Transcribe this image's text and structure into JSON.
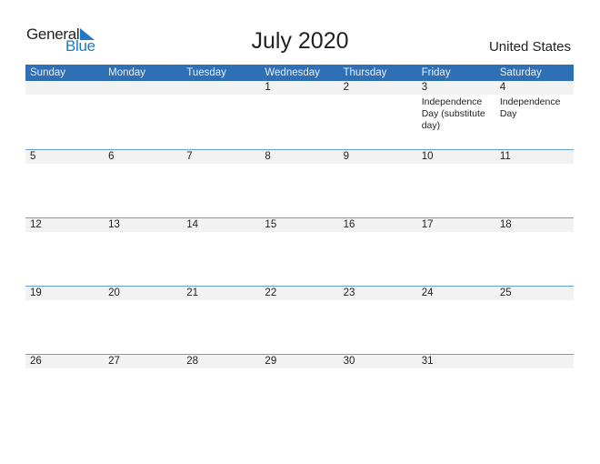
{
  "logo": {
    "general": "General",
    "blue": "Blue",
    "accent_color": "#1f78c8"
  },
  "title": "July 2020",
  "country": "United States",
  "header_color": "#2e6fb5",
  "weekdays": [
    "Sunday",
    "Monday",
    "Tuesday",
    "Wednesday",
    "Thursday",
    "Friday",
    "Saturday"
  ],
  "weeks": [
    [
      {
        "day": ""
      },
      {
        "day": ""
      },
      {
        "day": ""
      },
      {
        "day": "1"
      },
      {
        "day": "2"
      },
      {
        "day": "3",
        "event": "Independence Day (substitute day)"
      },
      {
        "day": "4",
        "event": "Independence Day"
      }
    ],
    [
      {
        "day": "5"
      },
      {
        "day": "6"
      },
      {
        "day": "7"
      },
      {
        "day": "8"
      },
      {
        "day": "9"
      },
      {
        "day": "10"
      },
      {
        "day": "11"
      }
    ],
    [
      {
        "day": "12"
      },
      {
        "day": "13"
      },
      {
        "day": "14"
      },
      {
        "day": "15"
      },
      {
        "day": "16"
      },
      {
        "day": "17"
      },
      {
        "day": "18"
      }
    ],
    [
      {
        "day": "19"
      },
      {
        "day": "20"
      },
      {
        "day": "21"
      },
      {
        "day": "22"
      },
      {
        "day": "23"
      },
      {
        "day": "24"
      },
      {
        "day": "25"
      }
    ],
    [
      {
        "day": "26"
      },
      {
        "day": "27"
      },
      {
        "day": "28"
      },
      {
        "day": "29"
      },
      {
        "day": "30"
      },
      {
        "day": "31"
      },
      {
        "day": ""
      }
    ]
  ]
}
